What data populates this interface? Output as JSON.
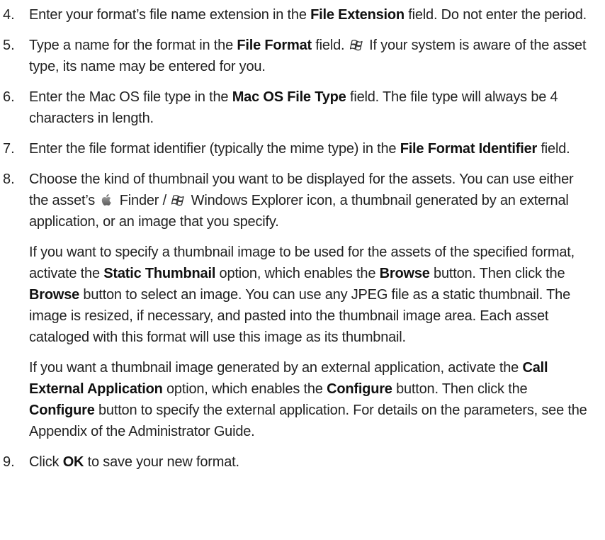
{
  "steps": [
    {
      "number": "4.",
      "paragraphs": [
        {
          "runs": [
            {
              "text": "Enter your format’s file name extension in the "
            },
            {
              "text": "File Extension",
              "bold": true
            },
            {
              "text": " field. Do not enter the period."
            }
          ]
        }
      ]
    },
    {
      "number": "5.",
      "paragraphs": [
        {
          "runs": [
            {
              "text": "Type a name for the format in the "
            },
            {
              "text": "File Format",
              "bold": true
            },
            {
              "text": " field. "
            },
            {
              "icon": "windows-icon"
            },
            {
              "text": " If your system is aware of the asset type, its name may be entered for you."
            }
          ]
        }
      ]
    },
    {
      "number": "6.",
      "paragraphs": [
        {
          "runs": [
            {
              "text": "Enter the Mac OS file type in the "
            },
            {
              "text": "Mac OS File Type",
              "bold": true
            },
            {
              "text": " field. The file type will always be 4 characters in length."
            }
          ]
        }
      ]
    },
    {
      "number": "7.",
      "paragraphs": [
        {
          "runs": [
            {
              "text": "Enter the file format identifier (typically the mime type) in the "
            },
            {
              "text": "File Format Identifier",
              "bold": true
            },
            {
              "text": " field."
            }
          ]
        }
      ]
    },
    {
      "number": "8.",
      "paragraphs": [
        {
          "runs": [
            {
              "text": "Choose the kind of thumbnail you want to be displayed for the assets. You can use either the asset’s "
            },
            {
              "icon": "apple-icon"
            },
            {
              "text": " Finder / "
            },
            {
              "icon": "windows-icon"
            },
            {
              "text": " Windows Explorer icon, a thumbnail generated by an external application, or an image that you specify."
            }
          ]
        },
        {
          "runs": [
            {
              "text": "If you want to specify a thumbnail image to be used for the assets of the specified format, activate the "
            },
            {
              "text": "Static Thumbnail",
              "bold": true
            },
            {
              "text": " option, which enables the "
            },
            {
              "text": "Browse",
              "bold": true
            },
            {
              "text": " button. Then click the "
            },
            {
              "text": "Browse",
              "bold": true
            },
            {
              "text": " button to select an image. You can use any JPEG file as a static thumbnail. The image is resized, if necessary, and pasted into the thumbnail image area. Each asset cataloged with this format will use this image as its thumbnail."
            }
          ]
        },
        {
          "runs": [
            {
              "text": "If you want a thumbnail image generated by an external application, acti­vate the "
            },
            {
              "text": "Call External Application",
              "bold": true
            },
            {
              "text": " option, which enables the "
            },
            {
              "text": "Configure",
              "bold": true
            },
            {
              "text": " button. Then click the "
            },
            {
              "text": "Configure",
              "bold": true
            },
            {
              "text": " button to specify the external application. For details on the parameters, see the Appendix of the Administrator Guide."
            }
          ]
        }
      ]
    },
    {
      "number": "9.",
      "paragraphs": [
        {
          "runs": [
            {
              "text": "Click "
            },
            {
              "text": "OK",
              "bold": true
            },
            {
              "text": " to save your new format."
            }
          ]
        }
      ]
    }
  ]
}
